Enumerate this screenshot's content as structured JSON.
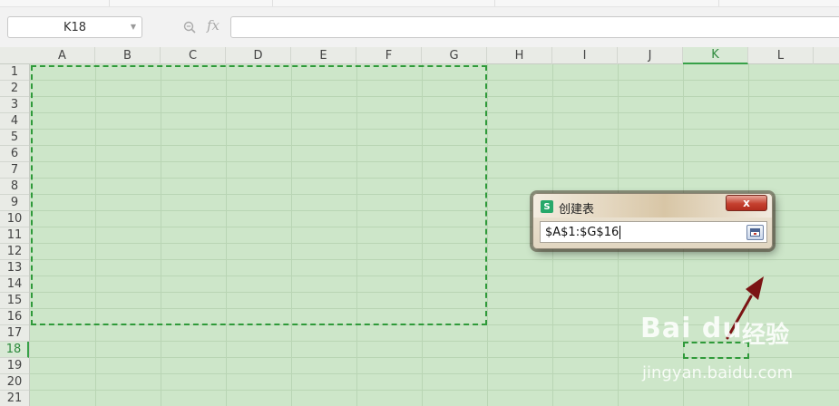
{
  "formula_bar": {
    "name_box": "K18",
    "fx_label": "fx",
    "formula_value": ""
  },
  "columns": [
    "A",
    "B",
    "C",
    "D",
    "E",
    "F",
    "G",
    "H",
    "I",
    "J",
    "K",
    "L"
  ],
  "rows": [
    "1",
    "2",
    "3",
    "4",
    "5",
    "6",
    "7",
    "8",
    "9",
    "10",
    "11",
    "12",
    "13",
    "14",
    "15",
    "16",
    "17",
    "18",
    "19",
    "20",
    "21"
  ],
  "active_cell": {
    "column": "K",
    "row": "18"
  },
  "selection_range": "A1:G16",
  "dialog": {
    "title": "创建表",
    "logo_letter": "S",
    "close_label": "x",
    "range_value": "$A$1:$G$16"
  },
  "watermark": {
    "logo_text": "Bai du",
    "logo_cn": "经验",
    "url": "jingyan.baidu.com"
  },
  "colors": {
    "grid_background": "#cde6c9",
    "marquee": "#2f9a3a",
    "active_header": "#37a148",
    "arrow": "#7b1414"
  },
  "icons": [
    "zoom-icon",
    "fx-icon",
    "collapse-dialog-icon",
    "close-icon",
    "app-logo-icon"
  ]
}
